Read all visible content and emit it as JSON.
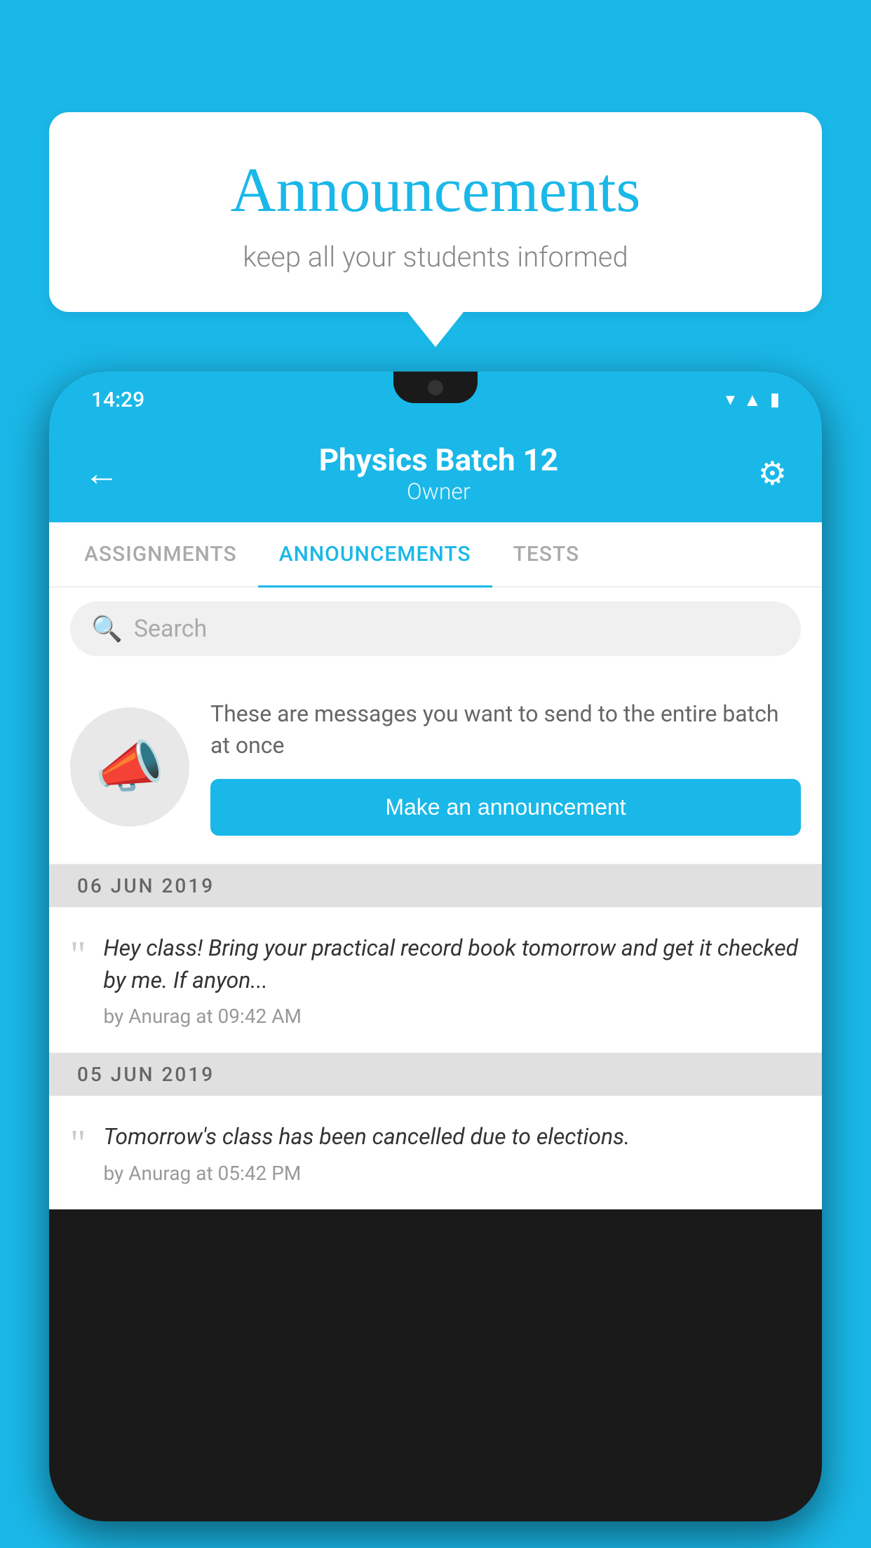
{
  "background_color": "#1ab8e8",
  "speech_bubble": {
    "title": "Announcements",
    "subtitle": "keep all your students informed"
  },
  "phone": {
    "status_bar": {
      "time": "14:29",
      "icons": [
        "wifi",
        "signal",
        "battery"
      ]
    },
    "header": {
      "title": "Physics Batch 12",
      "subtitle": "Owner",
      "back_label": "←",
      "gear_label": "⚙"
    },
    "tabs": [
      {
        "label": "ASSIGNMENTS",
        "active": false
      },
      {
        "label": "ANNOUNCEMENTS",
        "active": true
      },
      {
        "label": "TESTS",
        "active": false
      }
    ],
    "search": {
      "placeholder": "Search"
    },
    "promo": {
      "description": "These are messages you want to send to the entire batch at once",
      "button_label": "Make an announcement"
    },
    "announcements": [
      {
        "date": "06  JUN  2019",
        "text": "Hey class! Bring your practical record book tomorrow and get it checked by me. If anyon...",
        "meta": "by Anurag at 09:42 AM"
      },
      {
        "date": "05  JUN  2019",
        "text": "Tomorrow's class has been cancelled due to elections.",
        "meta": "by Anurag at 05:42 PM"
      }
    ]
  }
}
